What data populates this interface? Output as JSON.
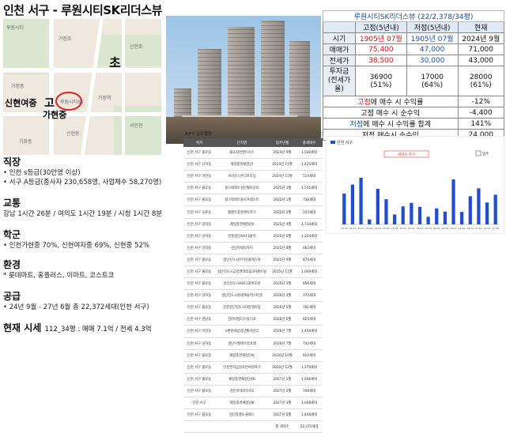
{
  "title": "인천 서구 - 루원시티SK리더스뷰",
  "map": {
    "label_cho": "초",
    "label_sinhyun": "신현여중",
    "label_go": "고",
    "label_gahyun": "가현중",
    "small_labels": [
      "루원시티",
      "가정초",
      "신현초",
      "가정중",
      "루원시티SK",
      "가정역",
      "서인천",
      "신현동",
      "가좌동"
    ]
  },
  "sections": {
    "job": {
      "heading": "직장",
      "lines": [
        "인천 s등급(30만명 이상)",
        "서구 A등급(종사자 230,658명, 사업체수 58,270명)"
      ]
    },
    "traffic": {
      "heading": "교통",
      "line": "강남 1시간 26분 / 여의도 1시간 19분 / 시청 1시간 8분"
    },
    "school": {
      "heading": "학군",
      "line": "인천가현중 70%, 신현여자중 69%, 신현중 52%"
    },
    "env": {
      "heading": "환경",
      "line": "롯데마트, 홈플러스, 이마트, 코스트코"
    },
    "supply": {
      "heading": "공급",
      "line": "24년 9월 - 27년 6월 총 22,372세대(인천 서구)"
    },
    "price": {
      "heading": "현재 시세",
      "detail": "112_34평 : 매매 7.1억 / 전세 4.3억"
    }
  },
  "summary": {
    "caption": "루원시티SK리더스뷰 (22/2,378/34평)",
    "col_hi": "고점(5년내)",
    "col_lo": "저점(5년내)",
    "col_now": "현재",
    "rows": [
      {
        "label": "시기",
        "hi": "1905년 07월",
        "lo": "1905년 07월",
        "now": "2024년 9월"
      },
      {
        "label": "매매가",
        "hi": "75,400",
        "lo": "47,000",
        "now": "71,000"
      },
      {
        "label": "전세가",
        "hi": "38,500",
        "lo": "30,000",
        "now": "43,000"
      },
      {
        "label": "투자금\n(전세가율)",
        "hi": "36900\n(51%)",
        "lo": "17000\n(64%)",
        "now": "28000\n(61%)"
      }
    ],
    "returns": [
      {
        "pre": "",
        "key": "고점",
        "post": "에 매수 시 수익률",
        "val": "-12%",
        "color": "red"
      },
      {
        "pre": "",
        "key": "",
        "post": "고점 매수 시 순수익",
        "val": "-4,400",
        "color": ""
      },
      {
        "pre": "",
        "key": "저점",
        "post": "에 매수 시 수익률 합계",
        "val": "141%",
        "color": "blue"
      },
      {
        "pre": "",
        "key": "",
        "post": "저점 매수시 순수익",
        "val": "24,000",
        "color": ""
      }
    ]
  },
  "apt": {
    "caption": "APT 입주물량",
    "source": "출처: 부동산지인",
    "headers": [
      "위치",
      "단지명",
      "입주년월",
      "총세대수"
    ],
    "rows": [
      [
        "인천 서구 불로동",
        "불로자연앤트리스",
        "2024년 9월",
        "1,500세대"
      ],
      [
        "인천 서구 당하동",
        "제일풍경채검단Ⅰ",
        "2024년 11월",
        "1,425세대"
      ],
      [
        "인천 서구 마전동",
        "브라운스톤더프라임",
        "2024년 11월",
        "514세대"
      ],
      [
        "인천 서구 불로동",
        "힐스테이트검단웰카운티",
        "2025년 1월",
        "1,535세대"
      ],
      [
        "인천 서구 불로동",
        "힐스테이트블로프레스트",
        "2025년 1월",
        "736세대"
      ],
      [
        "인천 서구 오류동",
        "월앤트중흥에듀파크",
        "2025년 2월",
        "243세대"
      ],
      [
        "인천 서구 당하동",
        "제일풍경채검단Ⅱ",
        "2025년 4월",
        "1,734세대"
      ],
      [
        "인천 서구 당하동",
        "인천검단AA13블럭",
        "2025년 6월",
        "1,224세대"
      ],
      [
        "인천 서구 당하동",
        "검단아테라자이",
        "2025년 8월",
        "483세대"
      ],
      [
        "인천 서구 불로동",
        "검단신도시우미린클래스원",
        "2025년 9월",
        "875세대"
      ],
      [
        "인천 서구 불로동",
        "검단신도시금강펜테리움3차센트럴",
        "2025년 11월",
        "1,049세대"
      ],
      [
        "인천 서구 불로동",
        "검단신도시AB11블록호반",
        "2026년 3월",
        "856세대"
      ],
      [
        "인천 서구 당하동",
        "검단신도시롯데캐슬넥스티엘",
        "2026년 4월",
        "372세대"
      ],
      [
        "인천 서구 불로동",
        "인천검단신도시대방엘리움",
        "2026년 5월",
        "781세대"
      ],
      [
        "인천 서구 원당동",
        "한라비발디스튜디오",
        "2026년 6월",
        "625세대"
      ],
      [
        "인천 서구 마전동",
        "e편한세상검단웰카운티",
        "2026년 7월",
        "1,456세대"
      ],
      [
        "인천 서구 당하동",
        "검단누벨에르라포레",
        "2026년 7월",
        "732세대"
      ],
      [
        "인천 서구 불로동",
        "제일풍경채검단Ⅳ",
        "2026년 10월",
        "610세대"
      ],
      [
        "인천 서구 불로동",
        "인천연희공원호반써밋파크",
        "2026년 12월",
        "1,370세대"
      ],
      [
        "인천 서구 불로동",
        "제일풍경채검단AB",
        "2027년 2월",
        "1,046세대"
      ],
      [
        "인천 서구 불로동",
        "검단아테라자이2",
        "2027년 2월",
        "709세대"
      ],
      [
        "인천 서구",
        "제일풍경채검단Ⅲ",
        "2027년 3월",
        "1,068세대"
      ],
      [
        "인천 서구 불로동",
        "검단중흥S-클래스",
        "2027년 6월",
        "1,446세대"
      ]
    ],
    "total_label": "총 세대수",
    "total": "22,372세대"
  },
  "chart_data": {
    "type": "bar",
    "legend": [
      "인천 서구"
    ],
    "buttons": [
      "세대수 추가",
      "입주"
    ],
    "categories": [
      "24.09",
      "24.11",
      "25.01",
      "25.02",
      "25.04",
      "25.06",
      "25.08",
      "25.09",
      "25.11",
      "26.03",
      "26.04",
      "26.05",
      "26.06",
      "26.07",
      "26.10",
      "26.12",
      "27.02",
      "27.03",
      "27.06"
    ],
    "values": [
      1500,
      1939,
      2271,
      243,
      1734,
      1224,
      483,
      875,
      1049,
      856,
      372,
      781,
      625,
      2188,
      610,
      1370,
      1755,
      1068,
      1446
    ],
    "ylim": [
      0,
      3000
    ],
    "color": "#1f4fd1"
  }
}
